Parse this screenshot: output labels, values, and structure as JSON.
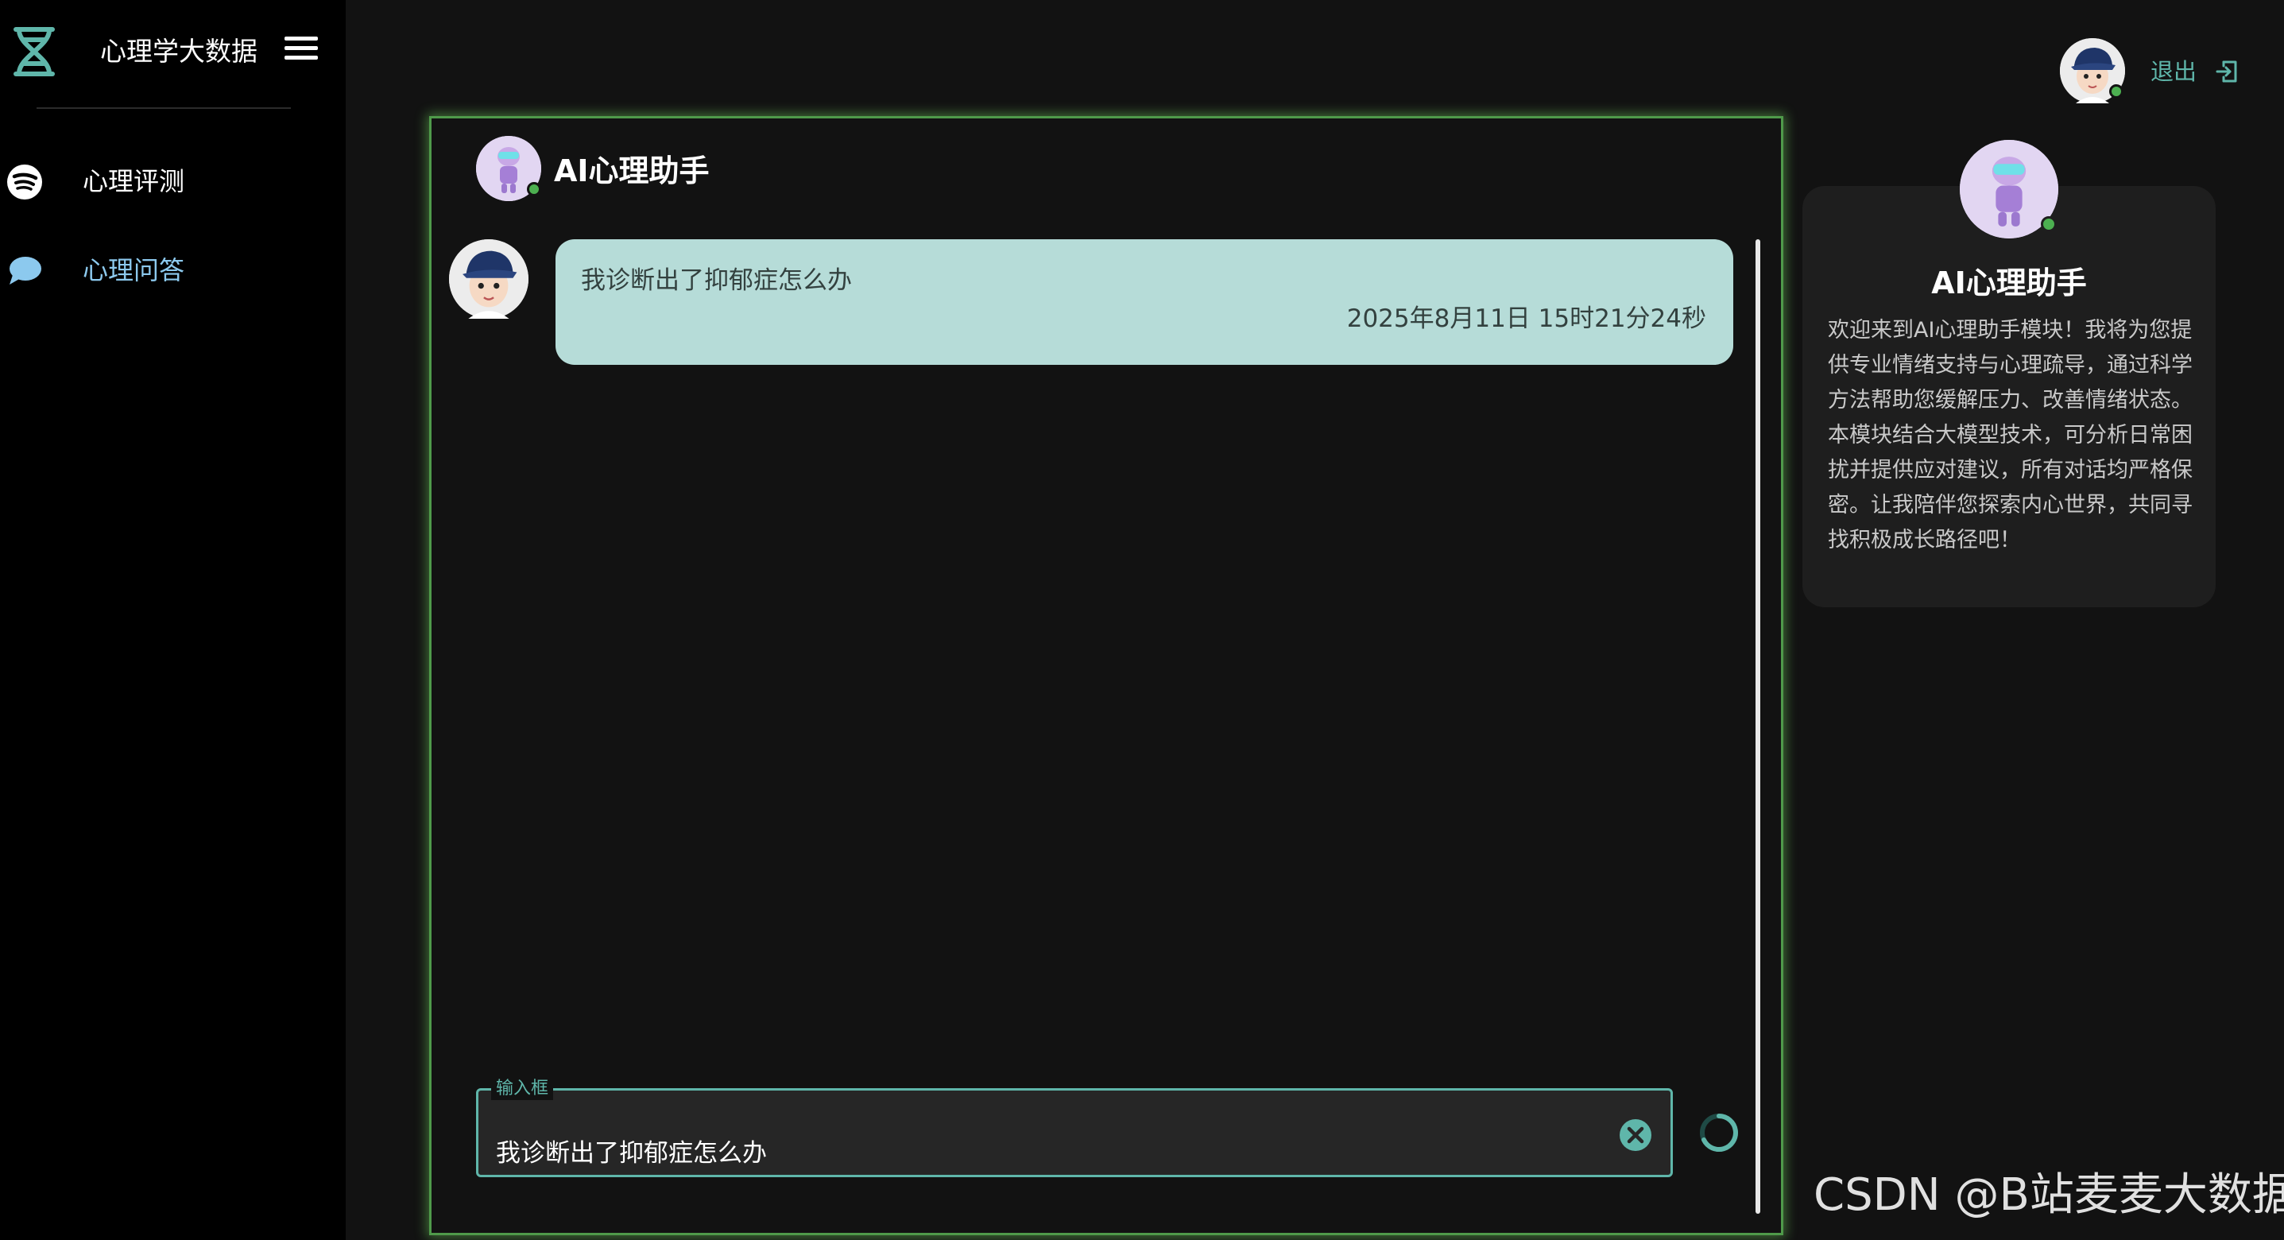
{
  "sidebar": {
    "brand_title": "心理学大数据",
    "items": [
      {
        "label": "心理评测",
        "icon": "spotify-icon"
      },
      {
        "label": "心理问答",
        "icon": "chat-bubble-icon"
      }
    ]
  },
  "header": {
    "logout_label": "退出",
    "avatar": "user-avatar-icon"
  },
  "chat": {
    "title": "AI心理助手",
    "messages": [
      {
        "text": "我诊断出了抑郁症怎么办",
        "time": "2025年8月11日 15时21分24秒"
      }
    ],
    "input": {
      "legend": "输入框",
      "value": "我诊断出了抑郁症怎么办"
    }
  },
  "info": {
    "title": "AI心理助手",
    "description": "欢迎来到AI心理助手模块！我将为您提供专业情绪支持与心理疏导，通过科学方法帮助您缓解压力、改善情绪状态。本模块结合大模型技术，可分析日常困扰并提供应对建议，所有对话均严格保密。让我陪伴您探索内心世界，共同寻找积极成长路径吧！"
  },
  "watermark": "CSDN @B站麦麦大数据",
  "colors": {
    "accent": "#5fb6aa",
    "bubble": "#b6dcd8",
    "panel_glow": "#4f9a4a",
    "online": "#4caf50",
    "nav_active": "#8cc9ee"
  }
}
